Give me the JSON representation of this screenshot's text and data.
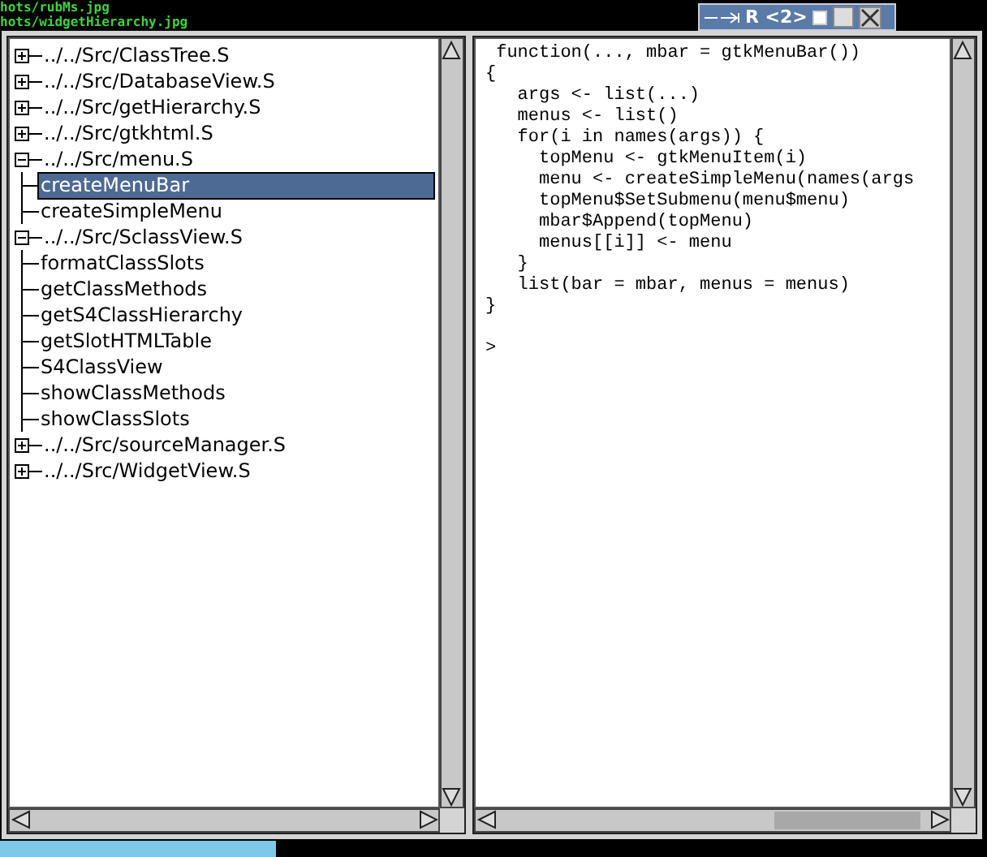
{
  "background_terminal": {
    "lines": [
      "hots/rubMs.jpg",
      "hots/widgetHierarchy.jpg"
    ]
  },
  "window": {
    "title": "R <2>"
  },
  "tree": [
    {
      "label": "../../Src/ClassTree.S",
      "expanded": false,
      "selected": false
    },
    {
      "label": "../../Src/DatabaseView.S",
      "expanded": false,
      "selected": false
    },
    {
      "label": "../../Src/getHierarchy.S",
      "expanded": false,
      "selected": false
    },
    {
      "label": "../../Src/gtkhtml.S",
      "expanded": false,
      "selected": false
    },
    {
      "label": "../../Src/menu.S",
      "expanded": true,
      "selected": false,
      "children": [
        {
          "label": "createMenuBar",
          "selected": true
        },
        {
          "label": "createSimpleMenu",
          "selected": false
        }
      ]
    },
    {
      "label": "../../Src/SclassView.S",
      "expanded": true,
      "selected": false,
      "children": [
        {
          "label": "formatClassSlots",
          "selected": false
        },
        {
          "label": "getClassMethods",
          "selected": false
        },
        {
          "label": "getS4ClassHierarchy",
          "selected": false
        },
        {
          "label": "getSlotHTMLTable",
          "selected": false
        },
        {
          "label": "S4ClassView",
          "selected": false
        },
        {
          "label": "showClassMethods",
          "selected": false
        },
        {
          "label": "showClassSlots",
          "selected": false
        }
      ]
    },
    {
      "label": "../../Src/sourceManager.S",
      "expanded": false,
      "selected": false
    },
    {
      "label": "../../Src/WidgetView.S",
      "expanded": false,
      "selected": false
    }
  ],
  "code_lines": [
    " function(..., mbar = gtkMenuBar())",
    "{",
    "   args <- list(...)",
    "   menus <- list()",
    "   for(i in names(args)) {",
    "     topMenu <- gtkMenuItem(i)",
    "     menu <- createSimpleMenu(names(args",
    "     topMenu$SetSubmenu(menu$menu)",
    "     mbar$Append(topMenu)",
    "     menus[[i]] <- menu",
    "   }",
    "   list(bar = mbar, menus = menus)",
    "}"
  ],
  "prompt": ">"
}
